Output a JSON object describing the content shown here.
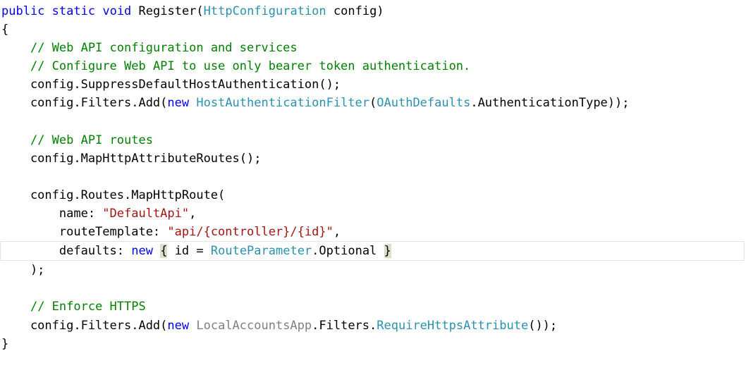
{
  "editor": {
    "language": "csharp",
    "theme": "visual-studio-light",
    "background": "#FFFFFF",
    "colors": {
      "keyword": "#0000FF",
      "type": "#2B91AF",
      "comment": "#008000",
      "string": "#A31515",
      "namespace": "#808080",
      "plain": "#000000",
      "brace_match_highlight": "#DCE0C8",
      "current_line_border": "#E6E6E6"
    },
    "current_line_index": 13,
    "lines": [
      {
        "index": 0,
        "tokens": [
          {
            "t": "public",
            "c": "kw"
          },
          {
            "t": " ",
            "c": "plain"
          },
          {
            "t": "static",
            "c": "kw"
          },
          {
            "t": " ",
            "c": "plain"
          },
          {
            "t": "void",
            "c": "kw"
          },
          {
            "t": " Register(",
            "c": "plain"
          },
          {
            "t": "HttpConfiguration",
            "c": "type"
          },
          {
            "t": " config)",
            "c": "plain"
          }
        ]
      },
      {
        "index": 1,
        "tokens": [
          {
            "t": "{",
            "c": "plain"
          }
        ]
      },
      {
        "index": 2,
        "tokens": [
          {
            "t": "    ",
            "c": "plain"
          },
          {
            "t": "// Web API configuration and services",
            "c": "cmt"
          }
        ]
      },
      {
        "index": 3,
        "tokens": [
          {
            "t": "    ",
            "c": "plain"
          },
          {
            "t": "// Configure Web API to use only bearer token authentication.",
            "c": "cmt"
          }
        ]
      },
      {
        "index": 4,
        "tokens": [
          {
            "t": "    config.SuppressDefaultHostAuthentication();",
            "c": "plain"
          }
        ]
      },
      {
        "index": 5,
        "tokens": [
          {
            "t": "    config.Filters.Add(",
            "c": "plain"
          },
          {
            "t": "new",
            "c": "kw"
          },
          {
            "t": " ",
            "c": "plain"
          },
          {
            "t": "HostAuthenticationFilter",
            "c": "type"
          },
          {
            "t": "(",
            "c": "plain"
          },
          {
            "t": "OAuthDefaults",
            "c": "type"
          },
          {
            "t": ".AuthenticationType));",
            "c": "plain"
          }
        ]
      },
      {
        "index": 6,
        "tokens": []
      },
      {
        "index": 7,
        "tokens": [
          {
            "t": "    ",
            "c": "plain"
          },
          {
            "t": "// Web API routes",
            "c": "cmt"
          }
        ]
      },
      {
        "index": 8,
        "tokens": [
          {
            "t": "    config.MapHttpAttributeRoutes();",
            "c": "plain"
          }
        ]
      },
      {
        "index": 9,
        "tokens": []
      },
      {
        "index": 10,
        "tokens": [
          {
            "t": "    config.Routes.MapHttpRoute(",
            "c": "plain"
          }
        ]
      },
      {
        "index": 11,
        "tokens": [
          {
            "t": "        name: ",
            "c": "plain"
          },
          {
            "t": "\"DefaultApi\"",
            "c": "str"
          },
          {
            "t": ",",
            "c": "plain"
          }
        ]
      },
      {
        "index": 12,
        "tokens": [
          {
            "t": "        routeTemplate: ",
            "c": "plain"
          },
          {
            "t": "\"api/{controller}/{id}\"",
            "c": "str"
          },
          {
            "t": ",",
            "c": "plain"
          }
        ]
      },
      {
        "index": 13,
        "current": true,
        "tokens": [
          {
            "t": "        defaults: ",
            "c": "plain"
          },
          {
            "t": "new",
            "c": "kw"
          },
          {
            "t": " ",
            "c": "plain"
          },
          {
            "t": "{",
            "c": "brace-hl"
          },
          {
            "t": " id = ",
            "c": "plain"
          },
          {
            "t": "RouteParameter",
            "c": "type"
          },
          {
            "t": ".Optional ",
            "c": "plain"
          },
          {
            "t": "}",
            "c": "brace-hl"
          }
        ]
      },
      {
        "index": 14,
        "tokens": [
          {
            "t": "    );",
            "c": "plain"
          }
        ]
      },
      {
        "index": 15,
        "tokens": []
      },
      {
        "index": 16,
        "tokens": [
          {
            "t": "    ",
            "c": "plain"
          },
          {
            "t": "// Enforce HTTPS",
            "c": "cmt"
          }
        ]
      },
      {
        "index": 17,
        "tokens": [
          {
            "t": "    config.Filters.Add(",
            "c": "plain"
          },
          {
            "t": "new",
            "c": "kw"
          },
          {
            "t": " ",
            "c": "plain"
          },
          {
            "t": "LocalAccountsApp",
            "c": "ns"
          },
          {
            "t": ".Filters.",
            "c": "plain"
          },
          {
            "t": "RequireHttpsAttribute",
            "c": "type"
          },
          {
            "t": "());",
            "c": "plain"
          }
        ]
      },
      {
        "index": 18,
        "tokens": [
          {
            "t": "}",
            "c": "plain"
          }
        ]
      }
    ],
    "plain_text": "public static void Register(HttpConfiguration config)\n{\n    // Web API configuration and services\n    // Configure Web API to use only bearer token authentication.\n    config.SuppressDefaultHostAuthentication();\n    config.Filters.Add(new HostAuthenticationFilter(OAuthDefaults.AuthenticationType));\n\n    // Web API routes\n    config.MapHttpAttributeRoutes();\n\n    config.Routes.MapHttpRoute(\n        name: \"DefaultApi\",\n        routeTemplate: \"api/{controller}/{id}\",\n        defaults: new { id = RouteParameter.Optional }\n    );\n\n    // Enforce HTTPS\n    config.Filters.Add(new LocalAccountsApp.Filters.RequireHttpsAttribute());\n}"
  }
}
